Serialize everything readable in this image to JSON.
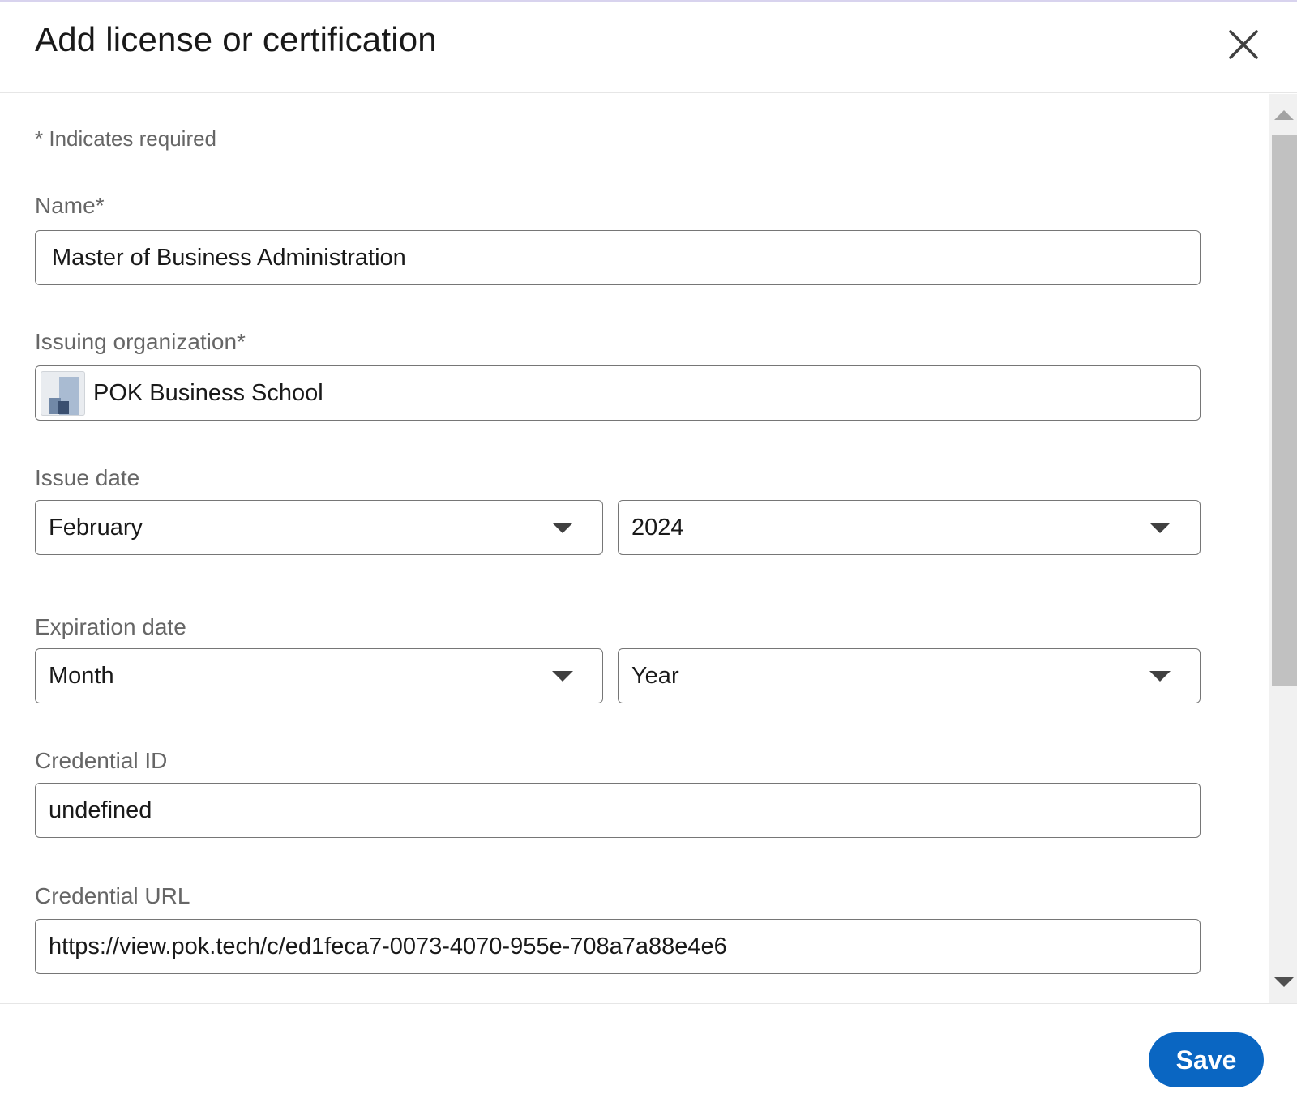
{
  "header": {
    "title": "Add license or certification",
    "close_icon": "close-icon"
  },
  "form": {
    "required_note": "* Indicates required",
    "name": {
      "label": "Name*",
      "value": "Master of Business Administration"
    },
    "issuing_org": {
      "label": "Issuing organization*",
      "value": "POK Business School",
      "logo_icon": "organization-logo-icon"
    },
    "issue_date": {
      "label": "Issue date",
      "month": "February",
      "year": "2024"
    },
    "expiration_date": {
      "label": "Expiration date",
      "month": "Month",
      "year": "Year"
    },
    "credential_id": {
      "label": "Credential ID",
      "value": "undefined"
    },
    "credential_url": {
      "label": "Credential URL",
      "value": "https://view.pok.tech/c/ed1feca7-0073-4070-955e-708a7a88e4e6"
    }
  },
  "footer": {
    "save_label": "Save"
  },
  "colors": {
    "primary": "#0a66c2",
    "border": "#767676",
    "label": "#666666",
    "text": "#191919"
  }
}
